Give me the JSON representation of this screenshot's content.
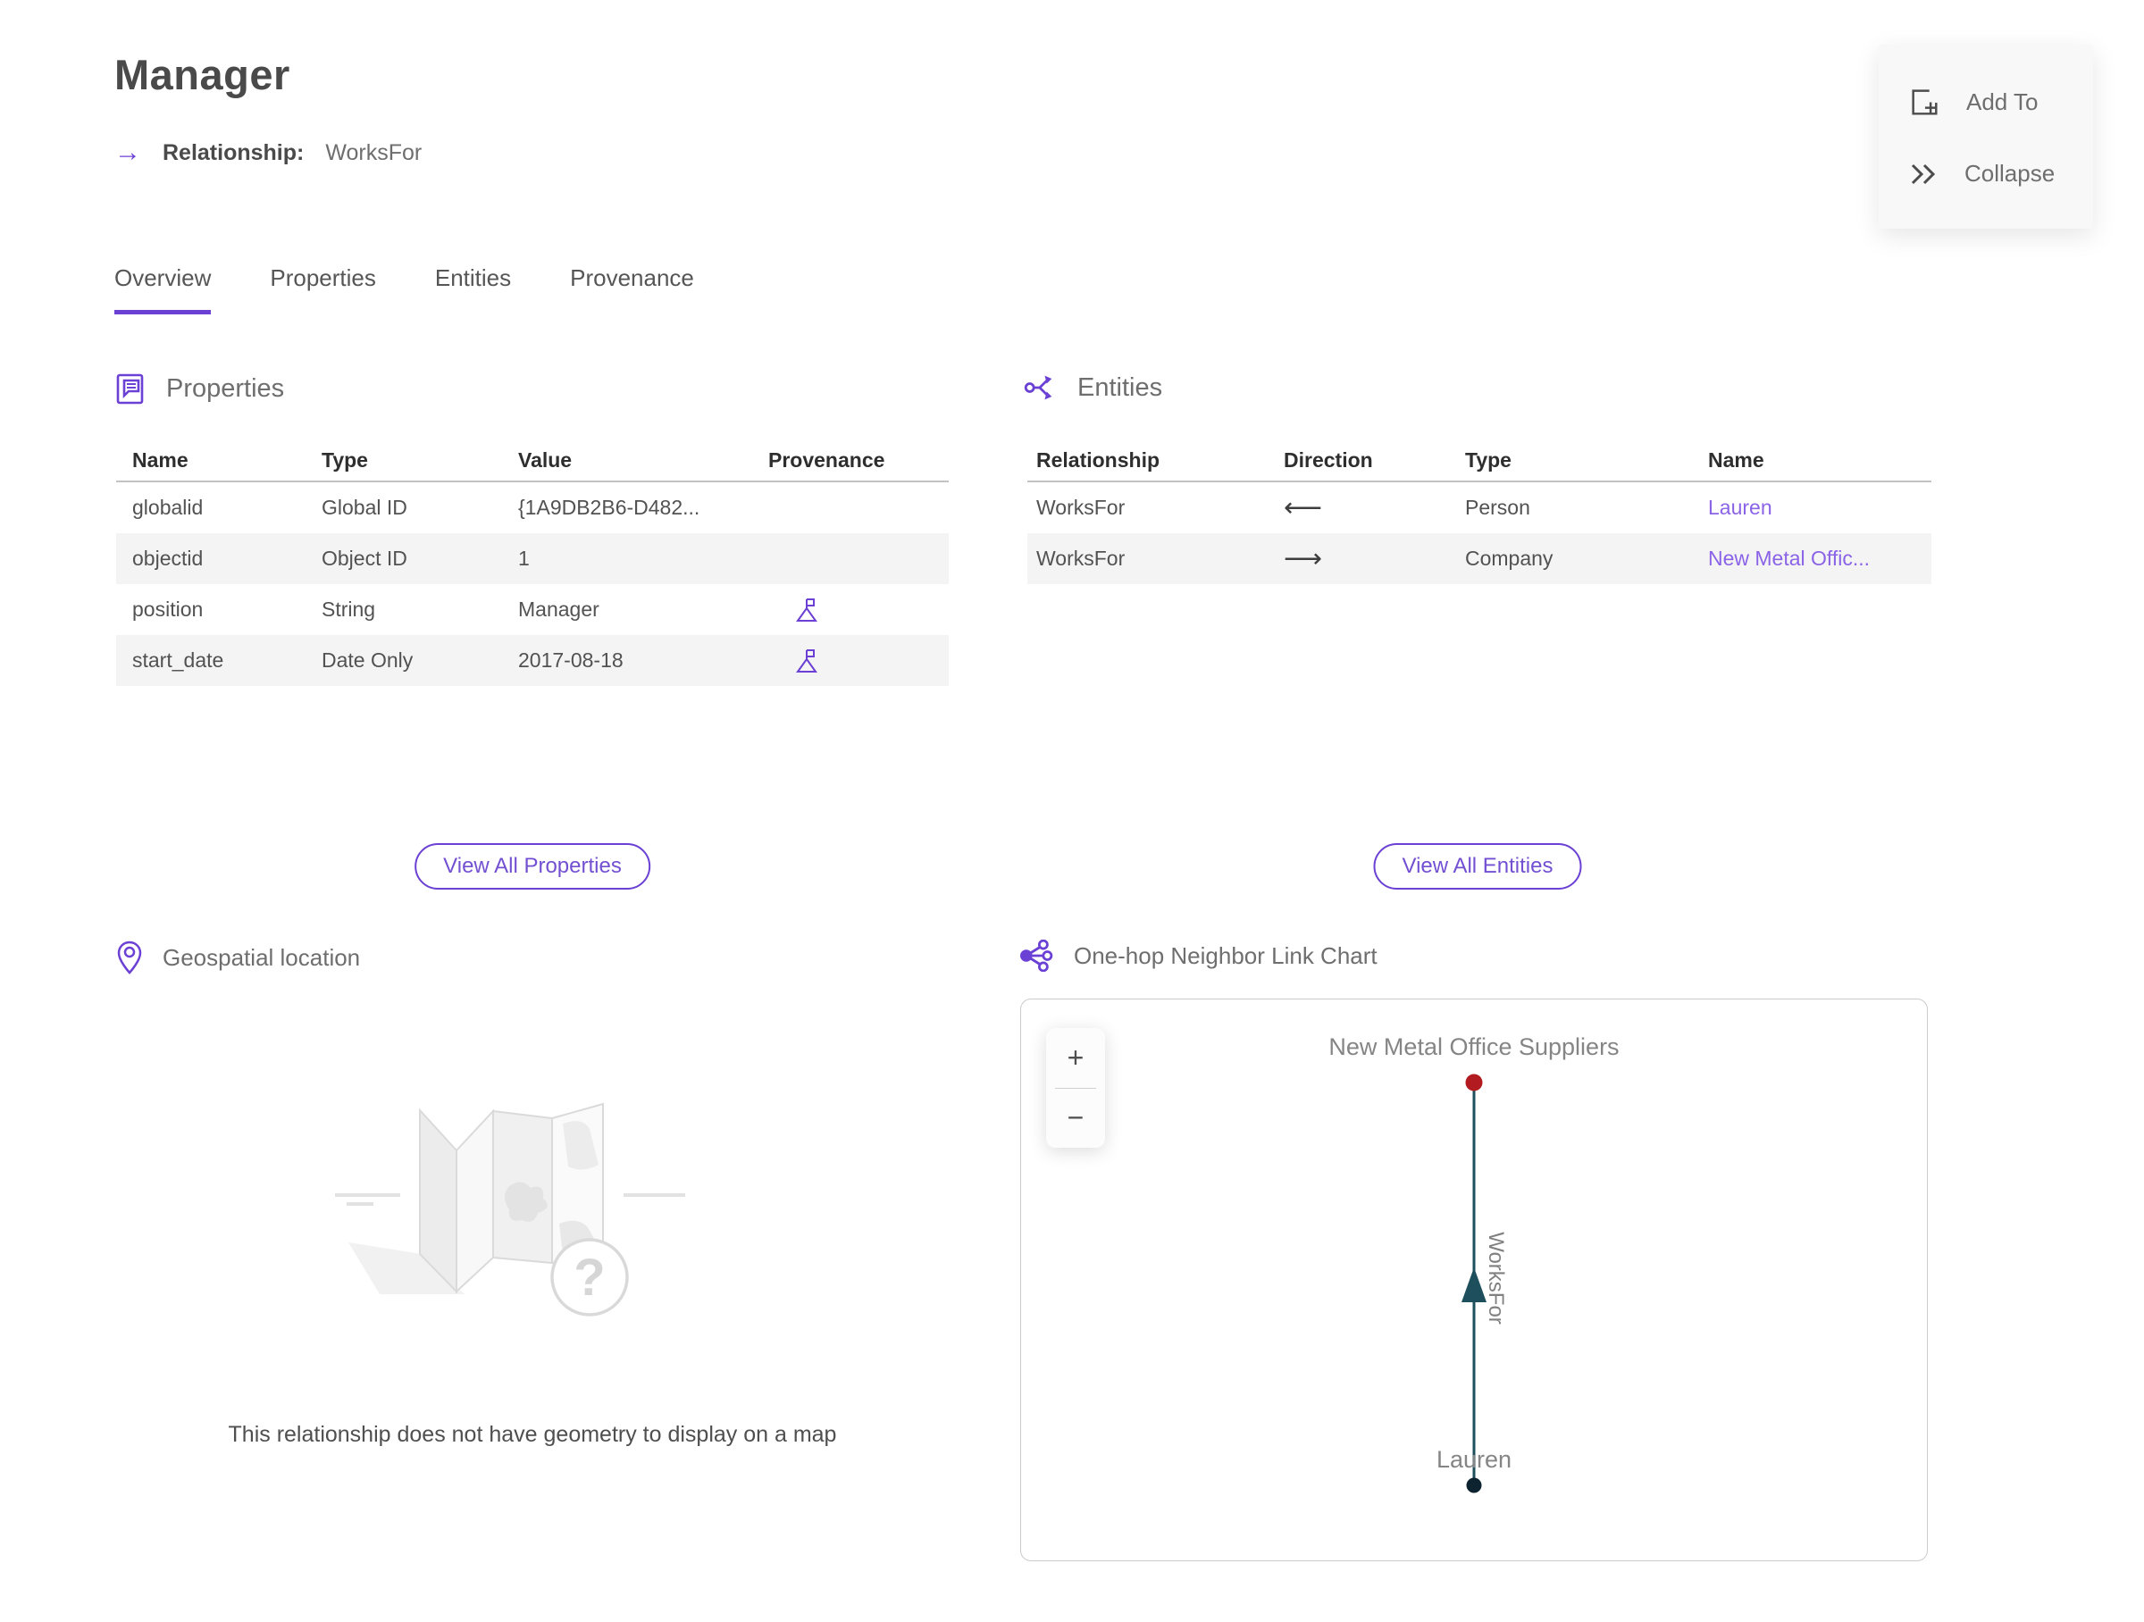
{
  "header": {
    "title": "Manager",
    "arrow_glyph": "→",
    "relationship_label": "Relationship:",
    "relationship_value": "WorksFor"
  },
  "actions_panel": {
    "add_to_label": "Add To",
    "collapse_label": "Collapse"
  },
  "tabs": [
    {
      "label": "Overview",
      "active": true
    },
    {
      "label": "Properties",
      "active": false
    },
    {
      "label": "Entities",
      "active": false
    },
    {
      "label": "Provenance",
      "active": false
    }
  ],
  "properties_section": {
    "title": "Properties",
    "columns": [
      "Name",
      "Type",
      "Value",
      "Provenance"
    ],
    "rows": [
      {
        "name": "globalid",
        "type": "Global ID",
        "value": "{1A9DB2B6-D482...",
        "has_provenance": false
      },
      {
        "name": "objectid",
        "type": "Object ID",
        "value": "1",
        "has_provenance": false
      },
      {
        "name": "position",
        "type": "String",
        "value": "Manager",
        "has_provenance": true
      },
      {
        "name": "start_date",
        "type": "Date Only",
        "value": "2017-08-18",
        "has_provenance": true
      }
    ],
    "view_all_label": "View All Properties"
  },
  "entities_section": {
    "title": "Entities",
    "columns": [
      "Relationship",
      "Direction",
      "Type",
      "Name"
    ],
    "rows": [
      {
        "relationship": "WorksFor",
        "direction": "⟵",
        "type": "Person",
        "name": "Lauren"
      },
      {
        "relationship": "WorksFor",
        "direction": "⟶",
        "type": "Company",
        "name": "New Metal Offic..."
      }
    ],
    "view_all_label": "View All Entities"
  },
  "geospatial_section": {
    "title": "Geospatial location",
    "placeholder_glyph": "?",
    "empty_message": "This relationship does not have geometry to display on a map"
  },
  "link_chart_section": {
    "title": "One-hop Neighbor Link Chart",
    "zoom_in_label": "+",
    "zoom_out_label": "−",
    "chart": {
      "type": "node-link",
      "nodes": [
        {
          "label": "New Metal Office Suppliers",
          "color": "#b21b20",
          "role": "target"
        },
        {
          "label": "Lauren",
          "color": "#0d2330",
          "role": "source"
        }
      ],
      "edges": [
        {
          "label": "WorksFor",
          "from": "Lauren",
          "to": "New Metal Office Suppliers",
          "color": "#1d4f5c",
          "arrow": "up"
        }
      ]
    }
  },
  "colors": {
    "accent": "#6b40d4",
    "link": "#8a63e6",
    "edge": "#1d4f5c",
    "node_red": "#b21b20",
    "node_dark": "#0d2330",
    "row_alt": "#f4f4f4"
  }
}
